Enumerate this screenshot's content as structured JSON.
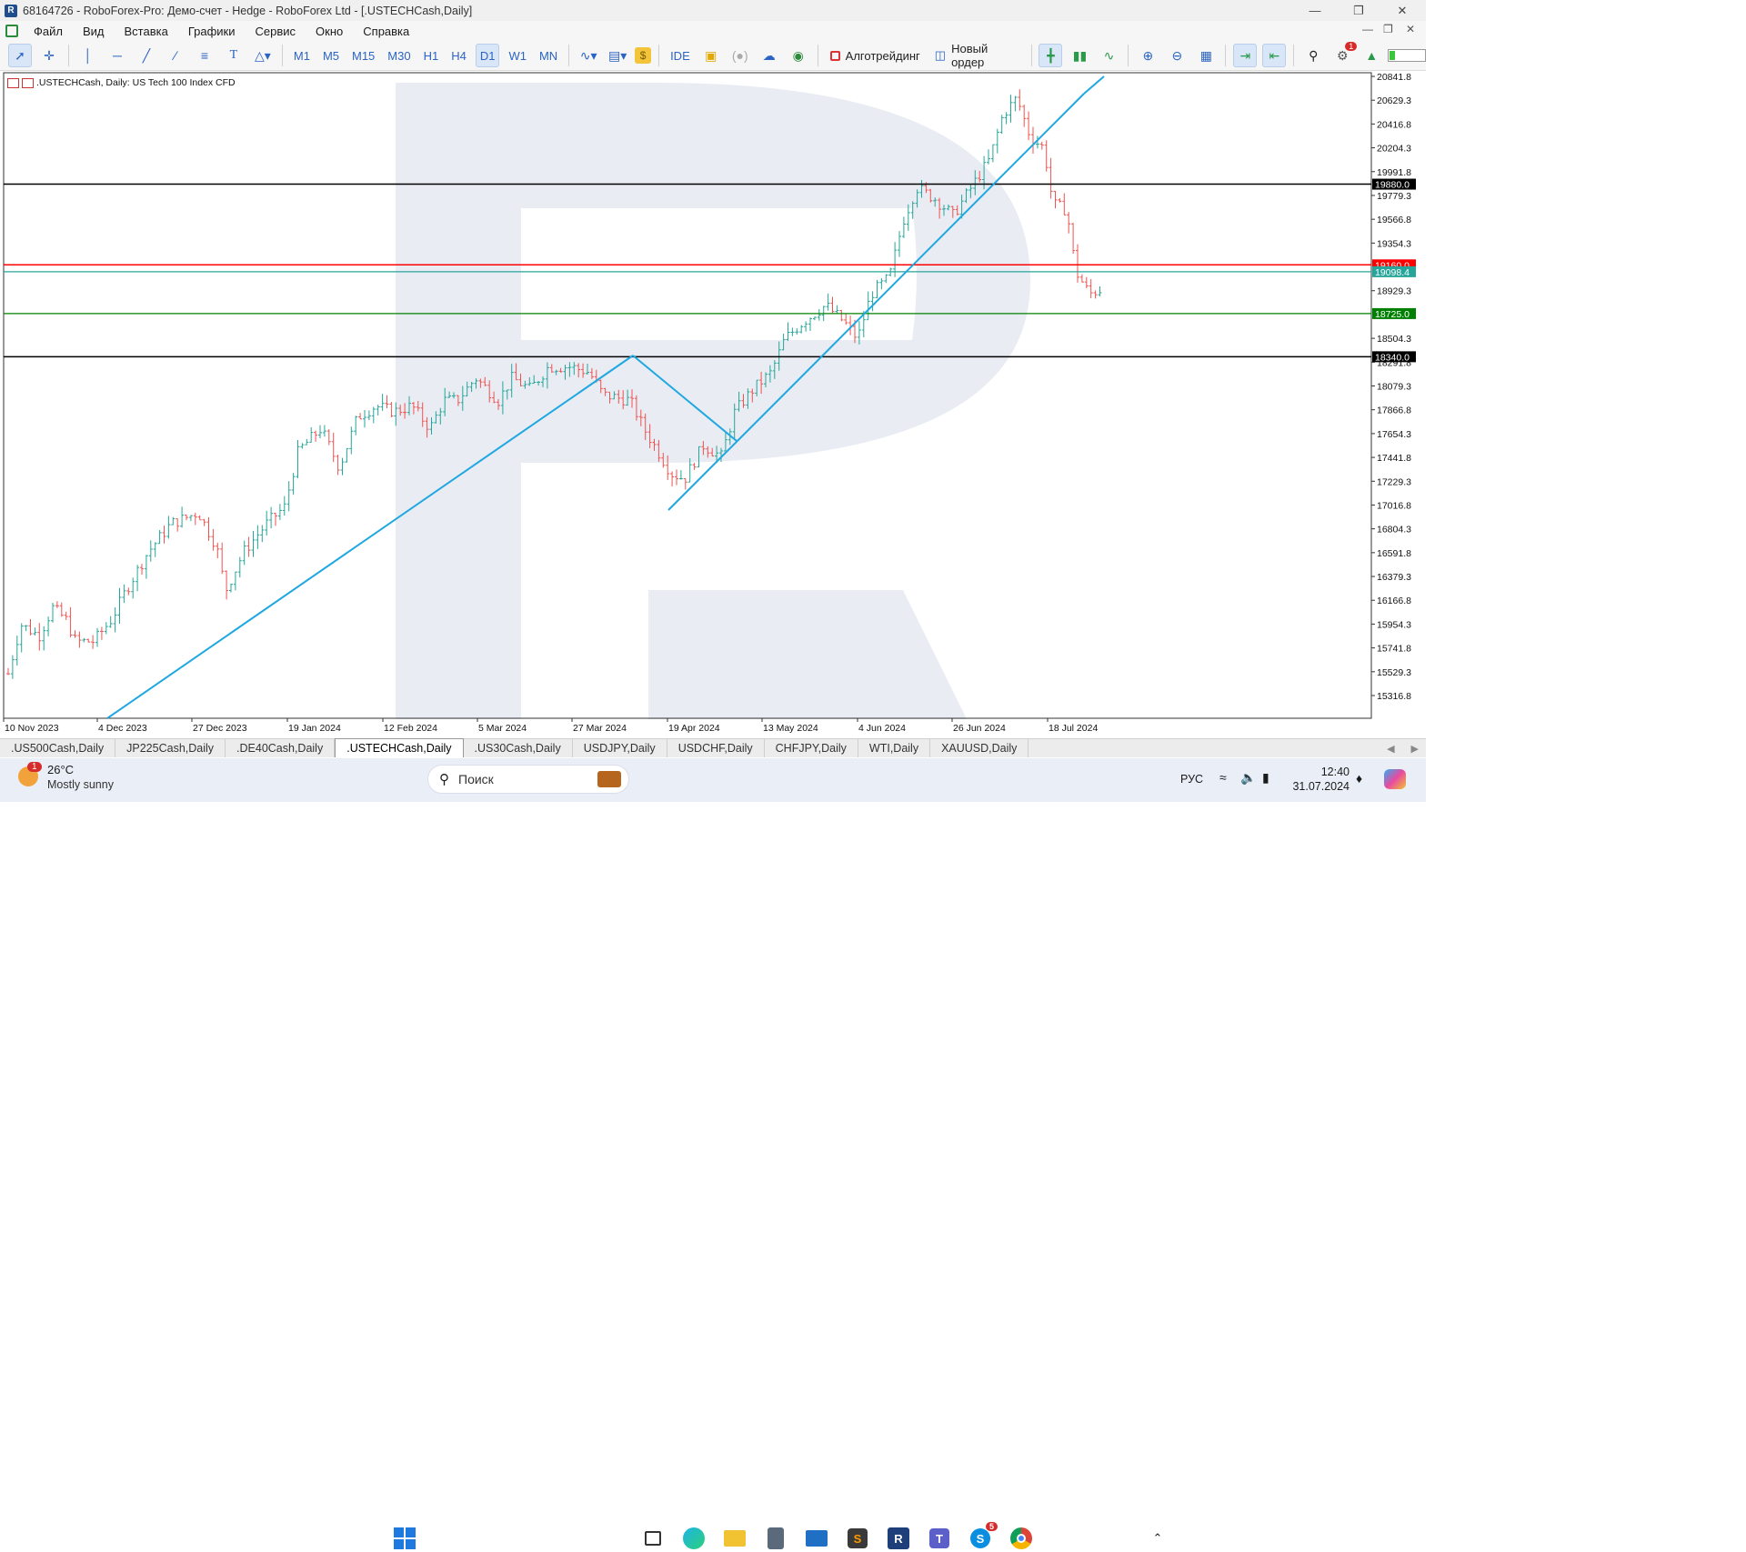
{
  "window": {
    "title": "68164726 - RoboForex-Pro: Демо-счет - Hedge - RoboForex Ltd - [.USTECHCash,Daily]"
  },
  "menu": [
    "Файл",
    "Вид",
    "Вставка",
    "Графики",
    "Сервис",
    "Окно",
    "Справка"
  ],
  "toolbar": {
    "timeframes": [
      "M1",
      "M5",
      "M15",
      "M30",
      "H1",
      "H4",
      "D1",
      "W1",
      "MN"
    ],
    "active_timeframe": "D1",
    "ide": "IDE",
    "algo": "Алготрейдинг",
    "new_order": "Новый ордер",
    "notifications": "1"
  },
  "chart": {
    "label": ".USTECHCash, Daily:  US Tech 100 Index CFD"
  },
  "chart_data": {
    "type": "candlestick",
    "symbol": ".USTECHCash",
    "timeframe": "Daily",
    "ylim": [
      15200,
      20900
    ],
    "y_ticks": [
      "20841.8",
      "20629.3",
      "20416.8",
      "20204.3",
      "19991.8",
      "19779.3",
      "19566.8",
      "19354.3",
      "18929.3",
      "18504.3",
      "18291.8",
      "18079.3",
      "17866.8",
      "17654.3",
      "17441.8",
      "17229.3",
      "17016.8",
      "16804.3",
      "16591.8",
      "16379.3",
      "16166.8",
      "15954.3",
      "15741.8",
      "15529.3",
      "15316.8"
    ],
    "x_ticks": [
      "10 Nov 2023",
      "4 Dec 2023",
      "27 Dec 2023",
      "19 Jan 2024",
      "12 Feb 2024",
      "5 Mar 2024",
      "27 Mar 2024",
      "19 Apr 2024",
      "13 May 2024",
      "4 Jun 2024",
      "26 Jun 2024",
      "18 Jul 2024"
    ],
    "levels": [
      {
        "value": 19880.0,
        "label": "19880.0",
        "color": "#000000"
      },
      {
        "value": 19160.0,
        "label": "19160.0",
        "color": "#ff0000"
      },
      {
        "value": 19098.4,
        "label": "19098.4",
        "color": "#26a69a"
      },
      {
        "value": 18725.0,
        "label": "18725.0",
        "color": "#008000"
      },
      {
        "value": 18340.0,
        "label": "18340.0",
        "color": "#000000"
      }
    ],
    "up_color": "#26a69a",
    "down_color": "#ef5350",
    "trendline_color": "#1ea7e1"
  },
  "tabs": [
    ".US500Cash,Daily",
    "JP225Cash,Daily",
    ".DE40Cash,Daily",
    ".USTECHCash,Daily",
    ".US30Cash,Daily",
    "USDJPY,Daily",
    "USDCHF,Daily",
    "CHFJPY,Daily",
    "WTI,Daily",
    "XAUUSD,Daily"
  ],
  "active_tab": ".USTECHCash,Daily",
  "taskbar": {
    "weather_temp": "26°C",
    "weather_desc": "Mostly sunny",
    "weather_badge": "1",
    "search": "Поиск",
    "lang": "РУС",
    "time": "12:40",
    "date": "31.07.2024",
    "skype_badge": "5"
  }
}
